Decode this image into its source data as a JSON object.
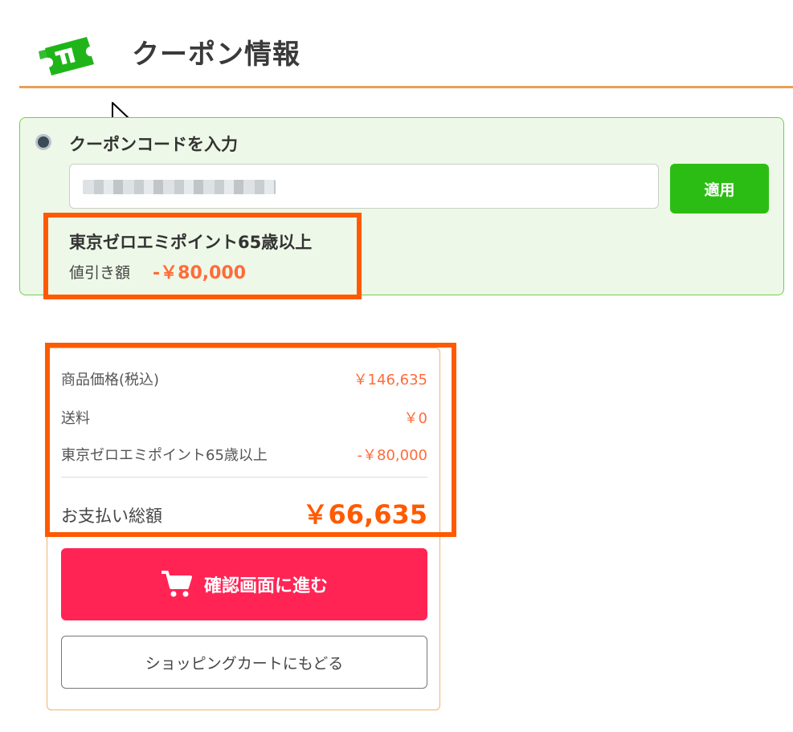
{
  "header": {
    "title": "クーポン情報",
    "icon": "coupon-ticket-icon"
  },
  "coupon": {
    "radio_label": "クーポンコードを入力",
    "input_value": "",
    "apply_label": "適用",
    "applied_name": "東京ゼロエミポイント65歳以上",
    "discount_label": "値引き額",
    "discount_value": "-￥80,000"
  },
  "summary": {
    "rows": [
      {
        "label": "商品価格(税込)",
        "value": "￥146,635"
      },
      {
        "label": "送料",
        "value": "￥0"
      },
      {
        "label": "東京ゼロエミポイント65歳以上",
        "value": "-￥80,000"
      }
    ],
    "total_label": "お支払い総額",
    "total_value": "￥66,635"
  },
  "actions": {
    "confirm_label": "確認画面に進む",
    "back_label": "ショッピングカートにもどる"
  },
  "colors": {
    "accent_orange": "#ff5a00",
    "apply_green": "#2cbd14",
    "confirm_pink": "#ff2454",
    "price_orange": "#ff6b3a"
  }
}
